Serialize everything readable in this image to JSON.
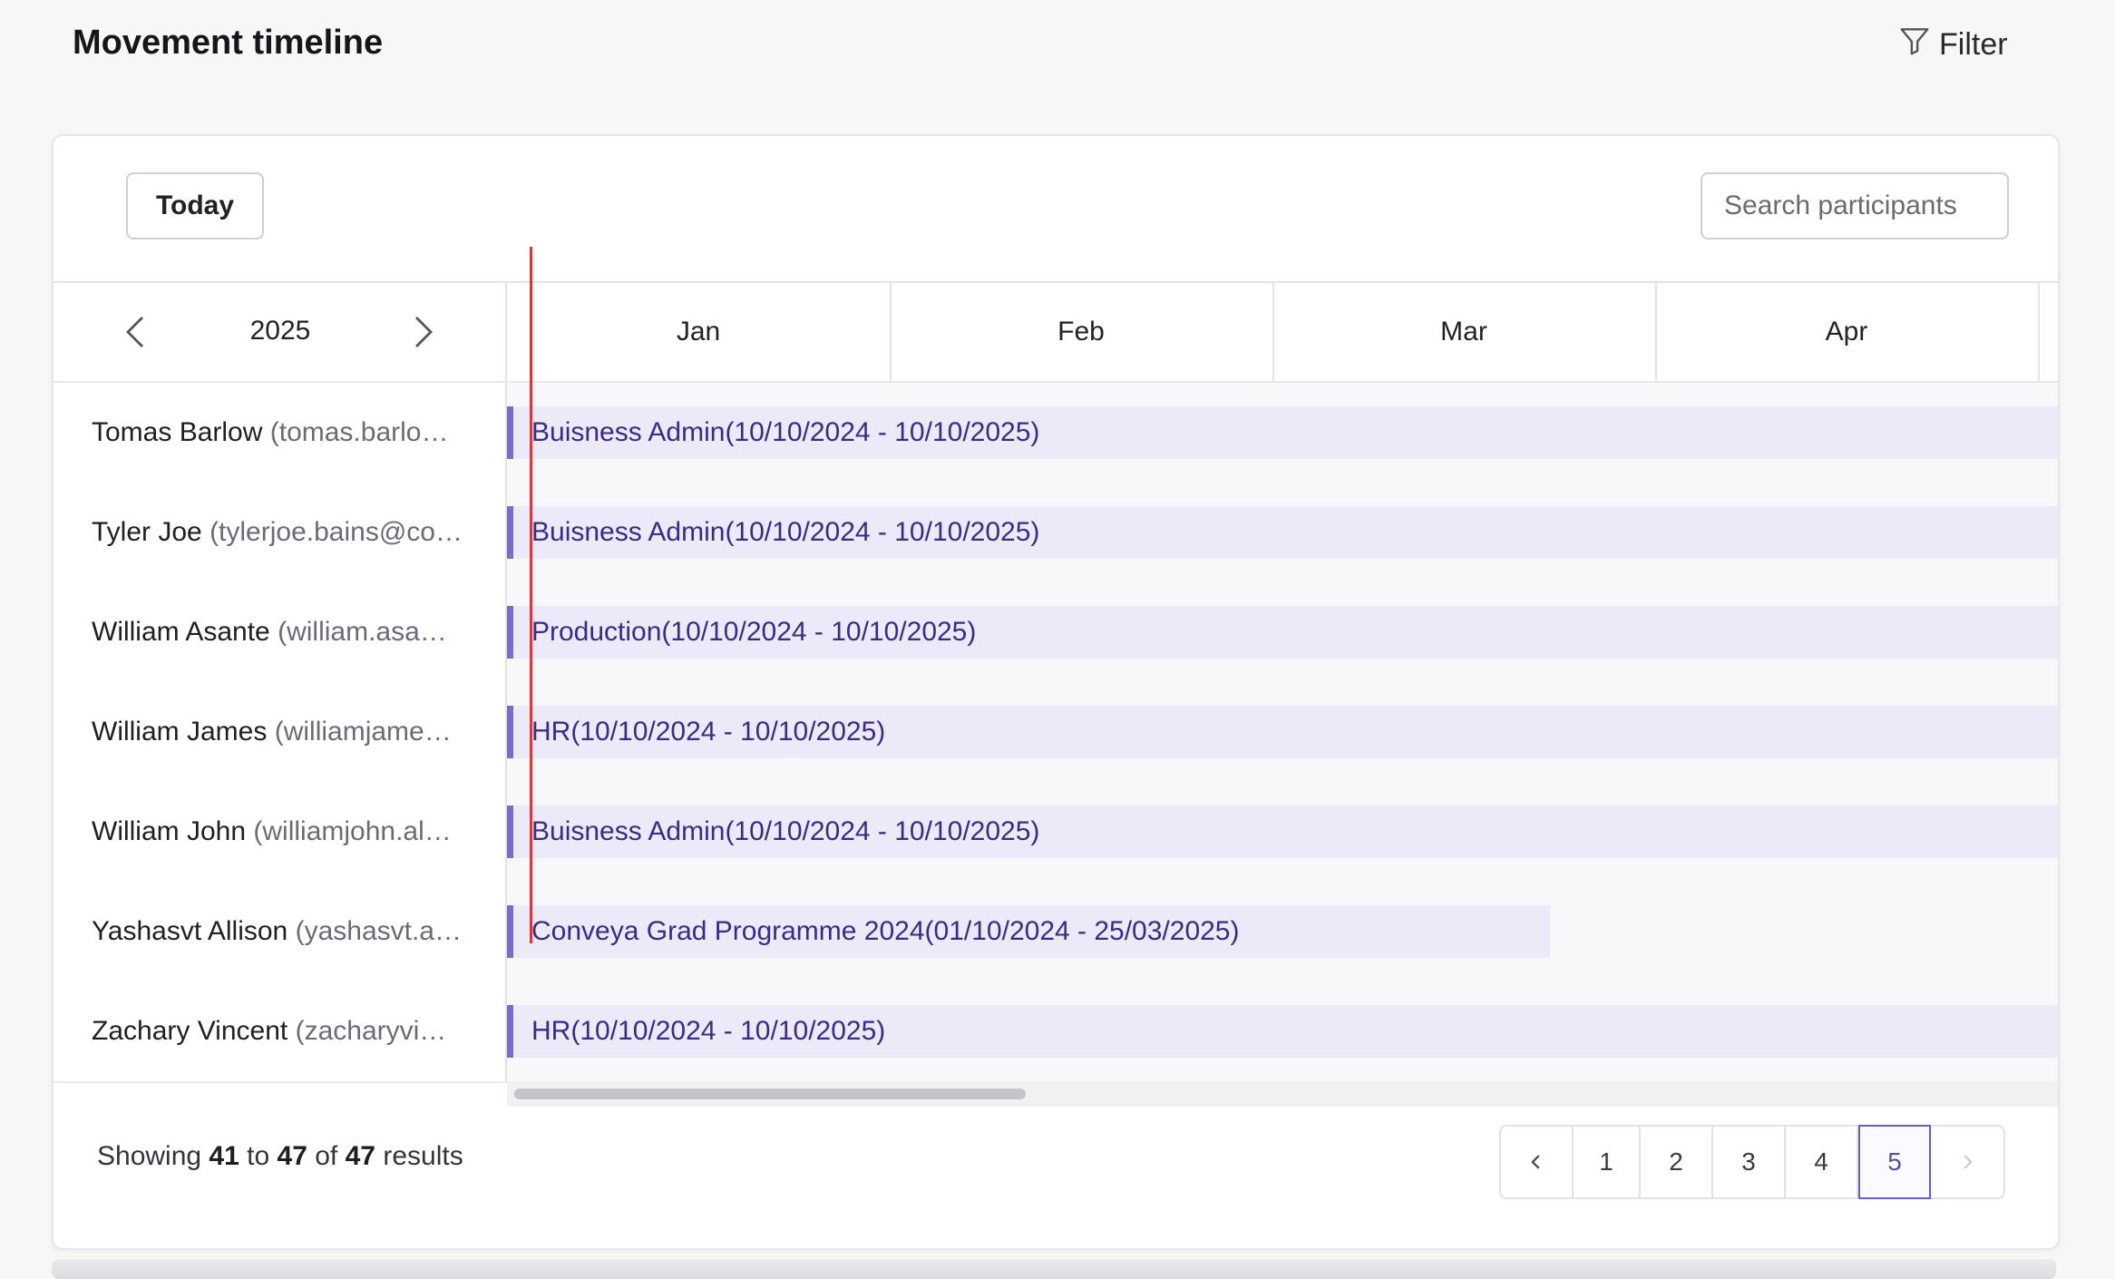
{
  "header": {
    "title": "Movement timeline",
    "filter_label": "Filter",
    "filter_icon": "funnel-icon"
  },
  "toolbar": {
    "today_label": "Today",
    "search_placeholder": "Search participants",
    "search_value": ""
  },
  "timeline": {
    "year": "2025",
    "months": [
      "Jan",
      "Feb",
      "Mar",
      "Apr"
    ],
    "rows": [
      {
        "name": "Tomas Barlow",
        "email": "(tomas.barlo…",
        "bar": "Buisness Admin(10/10/2024 - 10/10/2025)",
        "ends_early": false
      },
      {
        "name": "Tyler Joe",
        "email": "(tylerjoe.bains@co…",
        "bar": "Buisness Admin(10/10/2024 - 10/10/2025)",
        "ends_early": false
      },
      {
        "name": "William Asante",
        "email": "(william.asa…",
        "bar": "Production(10/10/2024 - 10/10/2025)",
        "ends_early": false
      },
      {
        "name": "William James",
        "email": "(williamjame…",
        "bar": "HR(10/10/2024 - 10/10/2025)",
        "ends_early": false
      },
      {
        "name": "William John",
        "email": "(williamjohn.al…",
        "bar": "Buisness Admin(10/10/2024 - 10/10/2025)",
        "ends_early": false
      },
      {
        "name": "Yashasvt Allison",
        "email": "(yashasvt.a…",
        "bar": "Conveya Grad Programme 2024(01/10/2024 - 25/03/2025)",
        "ends_early": true
      },
      {
        "name": "Zachary Vincent",
        "email": "(zacharyvi…",
        "bar": "HR(10/10/2024 - 10/10/2025)",
        "ends_early": false
      }
    ]
  },
  "footer": {
    "showing_prefix": "Showing",
    "from": "41",
    "to_word": "to",
    "to": "47",
    "of_word": "of",
    "total": "47",
    "results_word": "results"
  },
  "pagination": {
    "pages": [
      "1",
      "2",
      "3",
      "4",
      "5"
    ],
    "current": "5"
  },
  "colors": {
    "accent": "#7c6cc9",
    "bar_fill": "#eceaf9",
    "today_line": "#d43a3a"
  }
}
